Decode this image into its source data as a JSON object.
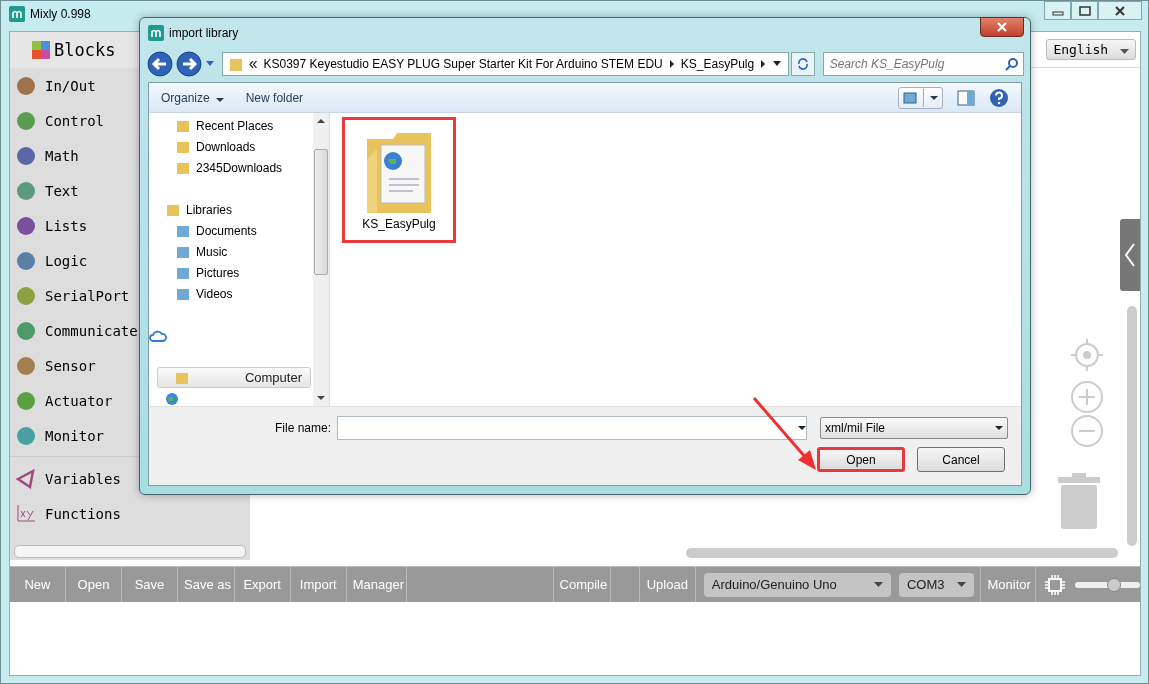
{
  "window": {
    "title": "Mixly 0.998"
  },
  "language": "English",
  "sidebar": {
    "header": "Blocks",
    "categories": [
      {
        "label": "In/Out"
      },
      {
        "label": "Control"
      },
      {
        "label": "Math"
      },
      {
        "label": "Text"
      },
      {
        "label": "Lists"
      },
      {
        "label": "Logic"
      },
      {
        "label": "SerialPort"
      },
      {
        "label": "Communicate"
      },
      {
        "label": "Sensor"
      },
      {
        "label": "Actuator"
      },
      {
        "label": "Monitor"
      }
    ],
    "extra": [
      {
        "label": "Variables"
      },
      {
        "label": "Functions"
      }
    ]
  },
  "toolbar": {
    "buttons": [
      "New",
      "Open",
      "Save",
      "Save as",
      "Export",
      "Import",
      "Manager"
    ],
    "compile": "Compile",
    "upload": "Upload",
    "board": "Arduino/Genuino Uno",
    "port": "COM3",
    "monitor": "Monitor",
    "zoom": {
      "level": 0.6
    }
  },
  "dialog": {
    "title": "import library",
    "path": [
      "KS0397 Keyestudio EASY PLUG Super Starter Kit For Arduino STEM EDU",
      "KS_EasyPulg"
    ],
    "search": {
      "placeholder": "Search KS_EasyPulg"
    },
    "commands": [
      {
        "label": "Organize",
        "menu": true
      },
      {
        "label": "New folder",
        "menu": false
      }
    ],
    "nav": [
      {
        "label": "Recent Places",
        "selected": false
      },
      {
        "label": "Downloads",
        "selected": false
      },
      {
        "label": "2345Downloads",
        "selected": false
      },
      {
        "label": "Libraries",
        "selected": false,
        "children": [
          {
            "label": "Documents",
            "selected": false
          },
          {
            "label": "Music",
            "selected": false
          },
          {
            "label": "Pictures",
            "selected": false
          },
          {
            "label": "Videos",
            "selected": false
          }
        ]
      },
      {
        "label": "Computer",
        "selected": true
      }
    ],
    "files": [
      {
        "name": "KS_EasyPulg",
        "highlighted": true
      }
    ],
    "file_name": {
      "label": "File name:"
    },
    "file_type": "xml/mil File",
    "buttons": [
      {
        "label": "Open",
        "highlighted": true
      },
      {
        "label": "Cancel",
        "highlighted": false
      }
    ]
  }
}
